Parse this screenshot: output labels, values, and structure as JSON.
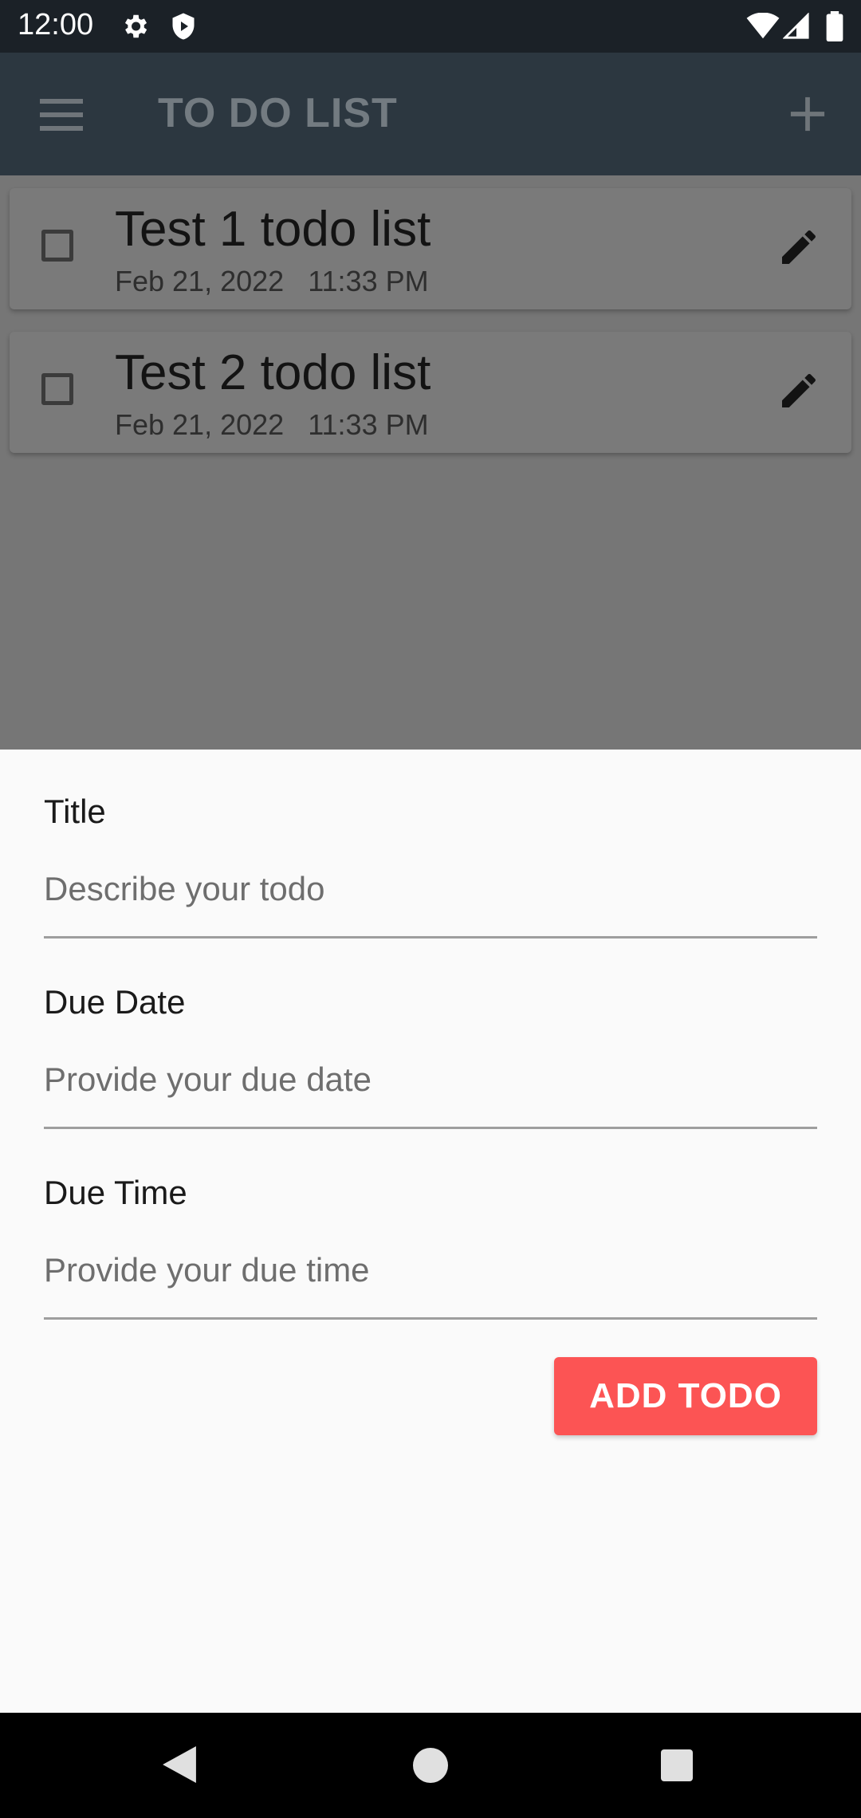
{
  "status_bar": {
    "time": "12:00",
    "icons": [
      "gear-icon",
      "shield-icon",
      "wifi-icon",
      "signal-icon",
      "battery-icon"
    ]
  },
  "app_bar": {
    "title": "TO DO LIST",
    "menu_icon": "menu-icon",
    "add_icon": "plus-icon"
  },
  "todos": [
    {
      "title": "Test 1 todo list",
      "date": "Feb 21, 2022",
      "time": "11:33 PM"
    },
    {
      "title": "Test 2 todo list",
      "date": "Feb 21, 2022",
      "time": "11:33 PM"
    }
  ],
  "form": {
    "title": {
      "label": "Title",
      "placeholder": "Describe your todo"
    },
    "due_date": {
      "label": "Due Date",
      "placeholder": "Provide your due date"
    },
    "due_time": {
      "label": "Due Time",
      "placeholder": "Provide your due time"
    },
    "submit_label": "ADD TODO"
  },
  "colors": {
    "accent": "#fc5454",
    "app_bar": "#2c3740",
    "status_bar": "#1b2127",
    "scrim_background": "#767676",
    "sheet_background": "#fafafa"
  },
  "nav_bar": {
    "icons": [
      "back-icon",
      "home-icon",
      "recents-icon"
    ]
  }
}
